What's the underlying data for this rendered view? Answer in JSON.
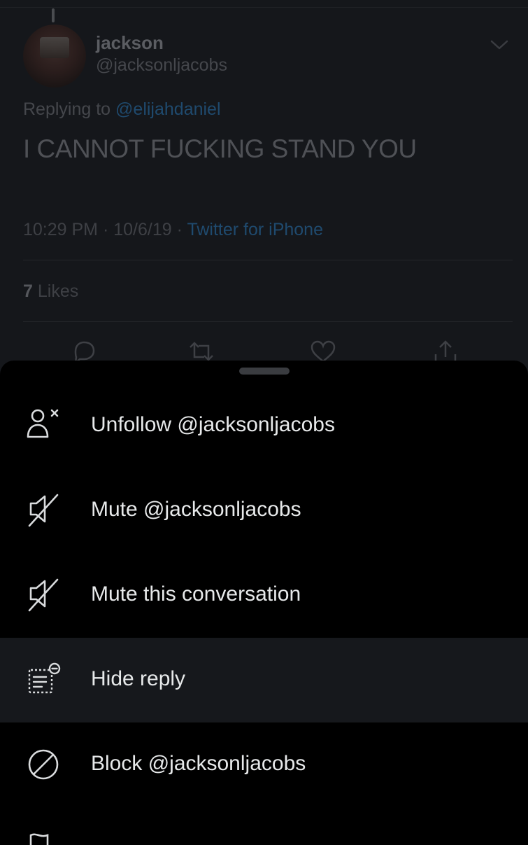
{
  "tweet": {
    "author_name": "jackson",
    "author_handle": "@jacksonljacobs",
    "replying_prefix": "Replying to",
    "replying_to": "@elijahdaniel",
    "text": "I CANNOT FUCKING STAND YOU",
    "time": "10:29 PM",
    "date": "10/6/19",
    "separator": "·",
    "source": "Twitter for iPhone",
    "likes_count": "7",
    "likes_label": "Likes"
  },
  "menu": {
    "items": [
      {
        "label": "Unfollow @jacksonljacobs",
        "icon": "unfollow-user-icon"
      },
      {
        "label": "Mute @jacksonljacobs",
        "icon": "mute-icon"
      },
      {
        "label": "Mute this conversation",
        "icon": "mute-icon"
      },
      {
        "label": "Hide reply",
        "icon": "hide-reply-icon",
        "highlighted": true
      },
      {
        "label": "Block @jacksonljacobs",
        "icon": "block-icon"
      }
    ]
  },
  "colors": {
    "background_dim": "#15171b",
    "sheet": "#000000",
    "highlight_row": "#16181c",
    "link_dim": "#1f4a6e",
    "text": "#e7e9ea"
  }
}
